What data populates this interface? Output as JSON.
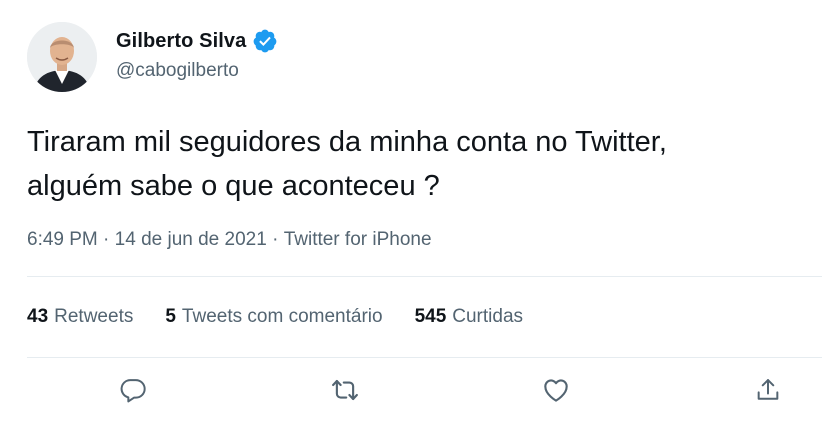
{
  "author": {
    "display_name": "Gilberto Silva",
    "handle": "@cabogilberto",
    "verified": true
  },
  "tweet": {
    "text": "Tiraram mil seguidores da minha conta no Twitter,\nalguém sabe o que aconteceu ?",
    "time": "6:49 PM",
    "separator": " · ",
    "date": "14 de jun de 2021",
    "source": "Twitter for iPhone"
  },
  "stats": {
    "retweets_count": "43",
    "retweets_label": "Retweets",
    "quotes_count": "5",
    "quotes_label": "Tweets com comentário",
    "likes_count": "545",
    "likes_label": "Curtidas"
  },
  "icons": {
    "verified": "verified-badge-icon",
    "reply": "reply-icon",
    "retweet": "retweet-icon",
    "like": "heart-icon",
    "share": "share-icon"
  },
  "colors": {
    "verified": "#1d9bf0",
    "secondary_text": "#536471",
    "primary_text": "#0f1419",
    "divider": "#e6ecf0"
  }
}
